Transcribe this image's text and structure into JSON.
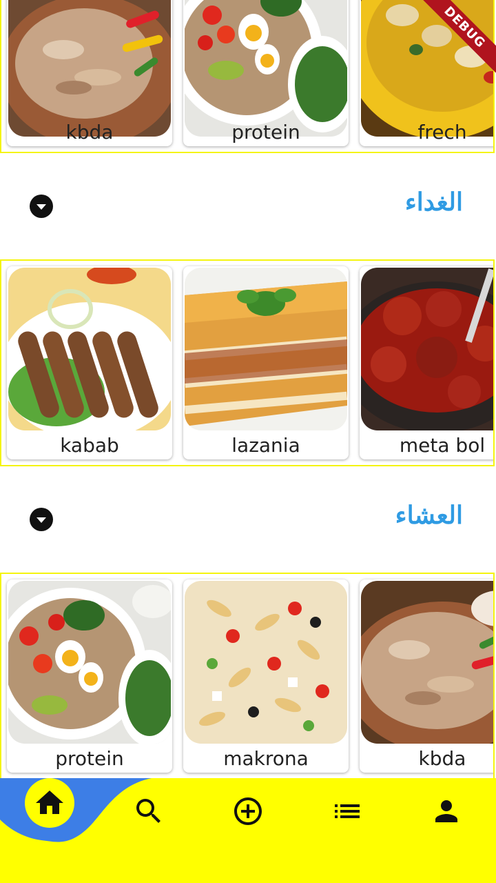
{
  "debug_banner": "DEBUG",
  "sections": {
    "top": {
      "items": [
        {
          "label": "kbda",
          "image": "grilled chicken shawarma with peppers"
        },
        {
          "label": "protein",
          "image": "egg quinoa and vegetable bowl"
        },
        {
          "label": "frech",
          "image": "chicken skewers on yellow plate"
        }
      ]
    },
    "lunch": {
      "title": "الغداء",
      "toggle_icon": "arrow-drop-down-circle-icon",
      "items": [
        {
          "label": "kabab",
          "image": "kebab skewers on lettuce"
        },
        {
          "label": "lazania",
          "image": "lasagna slice with basil"
        },
        {
          "label": "meta bol",
          "image": "meatballs in tomato sauce"
        }
      ]
    },
    "dinner": {
      "title": "العشاء",
      "toggle_icon": "arrow-drop-down-circle-icon",
      "items": [
        {
          "label": "protein",
          "image": "egg quinoa and vegetable bowl"
        },
        {
          "label": "makrona",
          "image": "pasta salad with tomatoes and olives"
        },
        {
          "label": "kbda",
          "image": "grilled chicken shawarma"
        }
      ]
    }
  },
  "bottom_nav": {
    "items": [
      {
        "icon": "home-icon",
        "active": true
      },
      {
        "icon": "search-icon",
        "active": false
      },
      {
        "icon": "add-circle-icon",
        "active": false
      },
      {
        "icon": "list-icon",
        "active": false
      },
      {
        "icon": "person-icon",
        "active": false
      }
    ]
  },
  "colors": {
    "accent_yellow": "#ffff00",
    "blob_blue": "#3d7ee6",
    "title_blue": "#2f9be3",
    "row_border": "#f4f40e"
  }
}
